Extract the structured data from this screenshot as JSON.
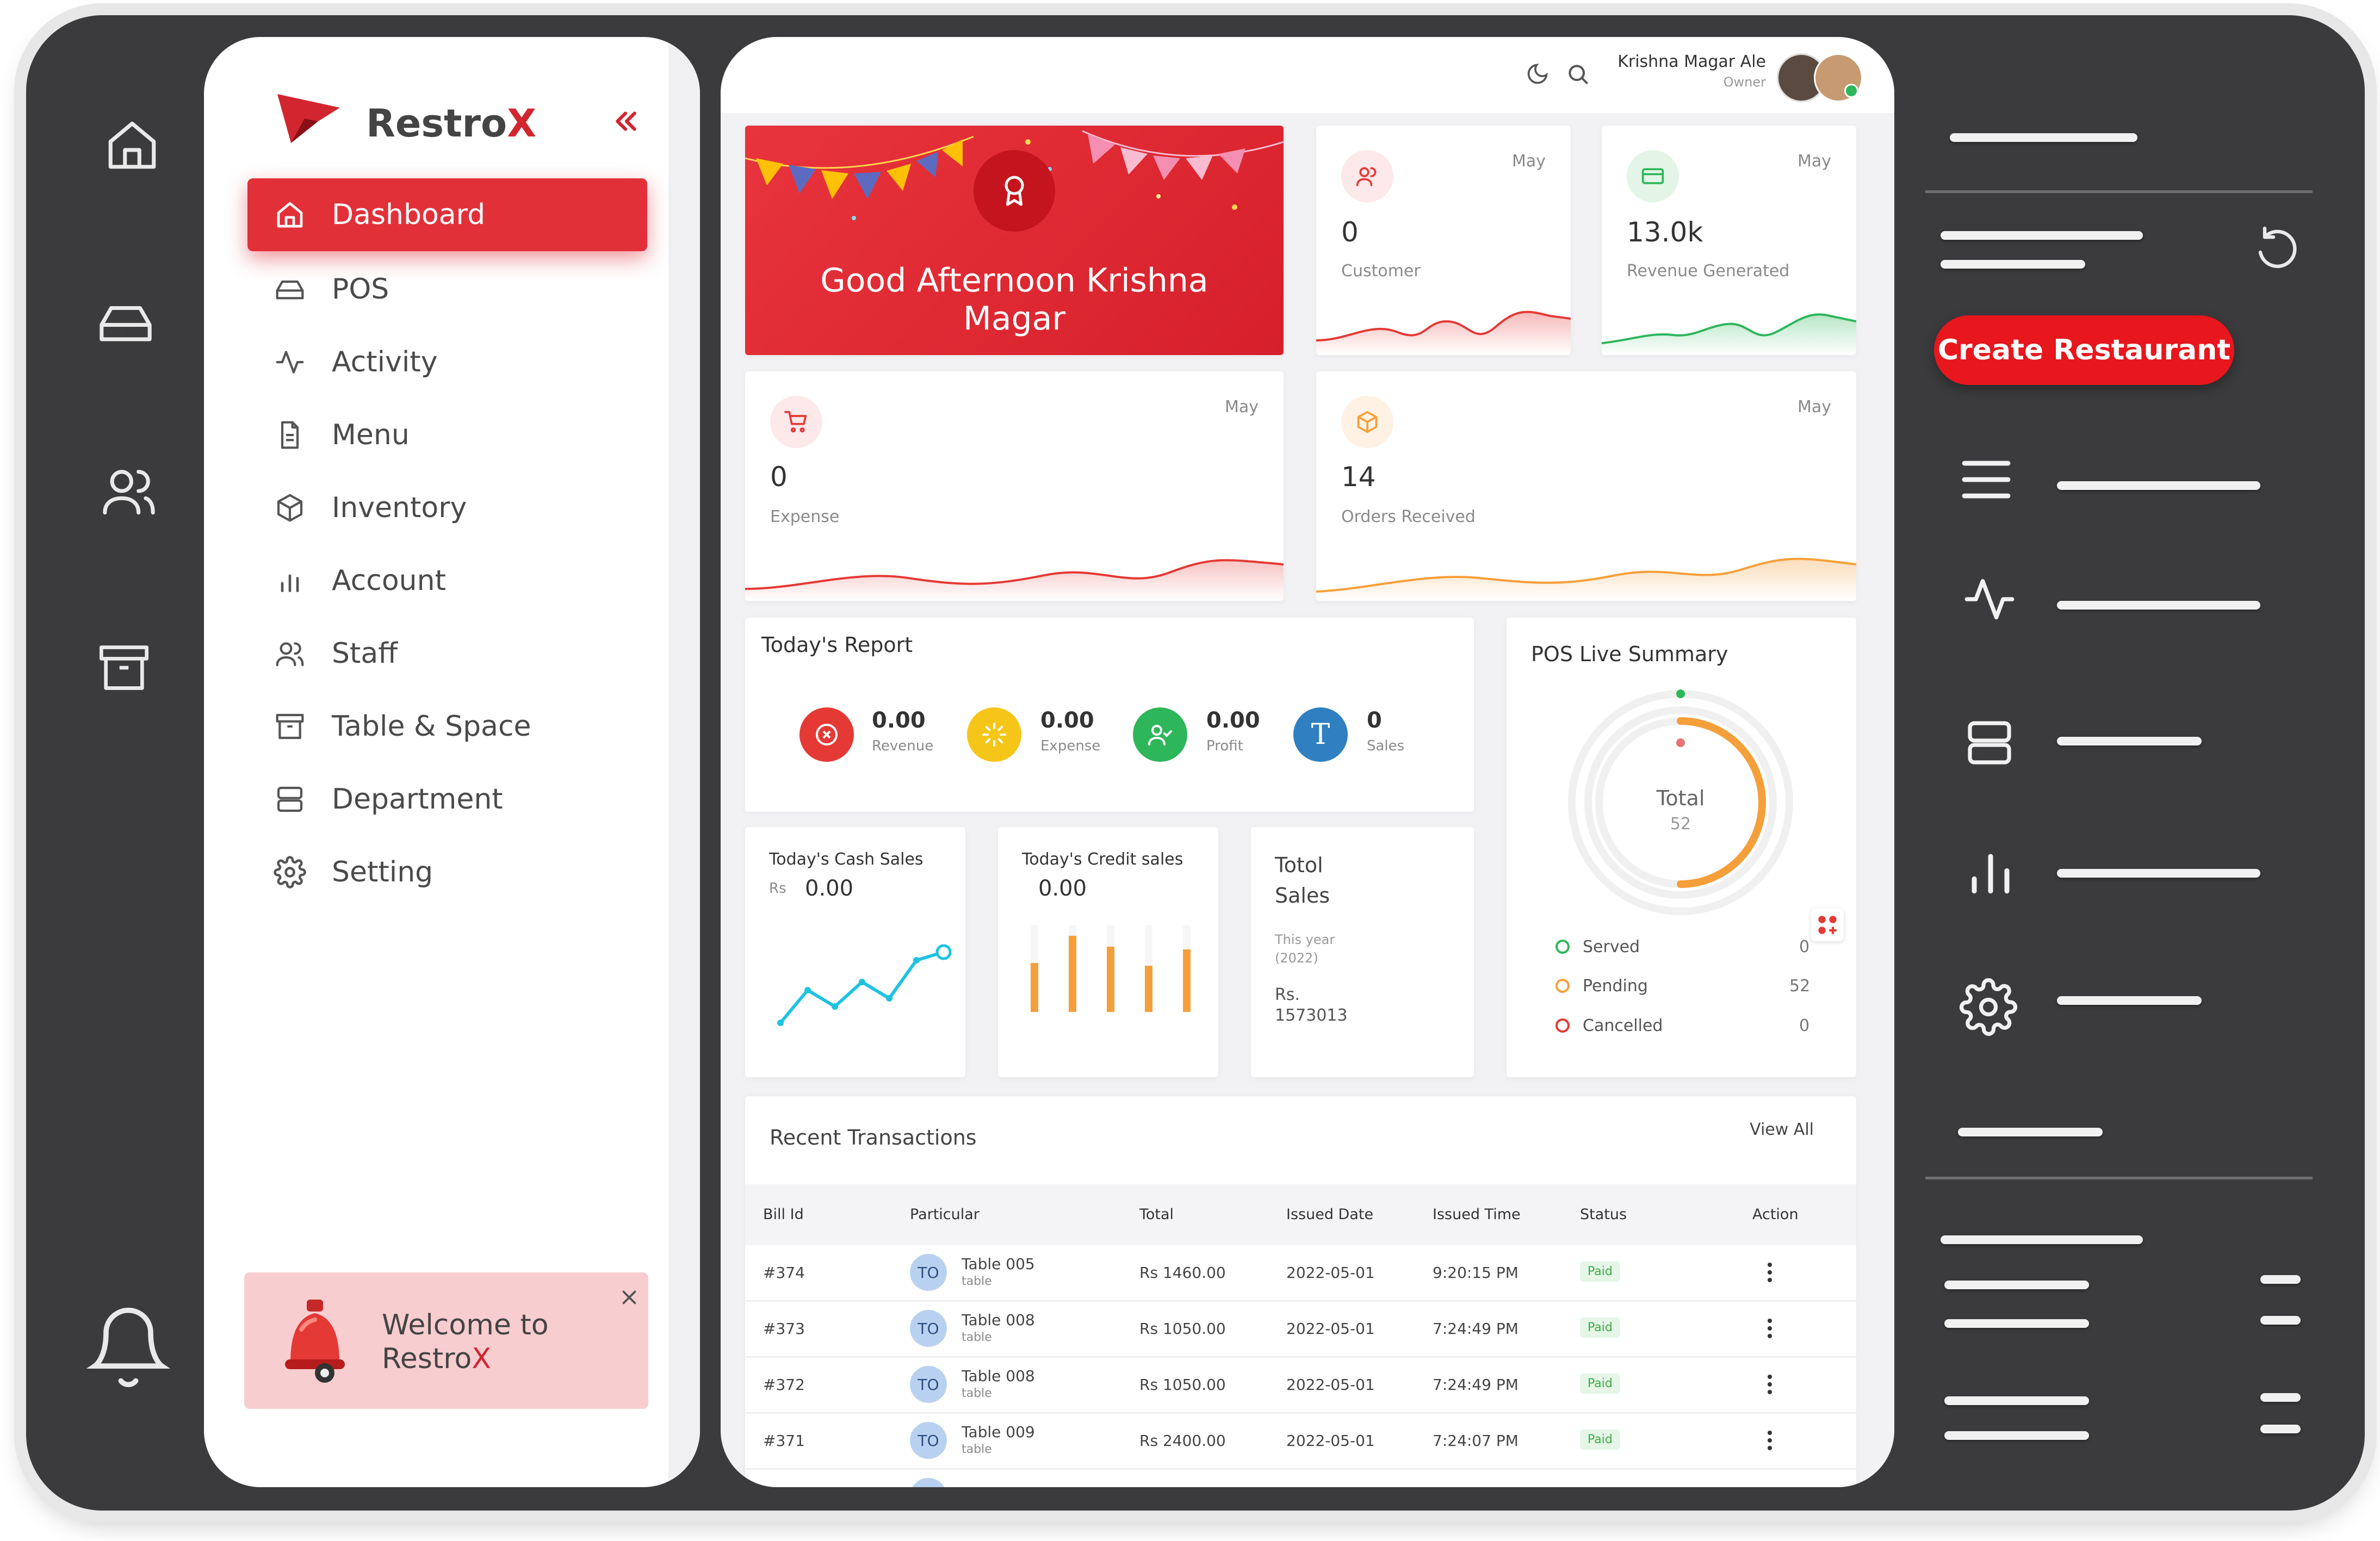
{
  "brand": {
    "name_main": "Restro",
    "name_accent": "X"
  },
  "nav": [
    {
      "label": "Dashboard",
      "icon": "home-icon",
      "active": true
    },
    {
      "label": "POS",
      "icon": "drive-icon"
    },
    {
      "label": "Activity",
      "icon": "activity-icon"
    },
    {
      "label": "Menu",
      "icon": "file-icon"
    },
    {
      "label": "Inventory",
      "icon": "box-icon"
    },
    {
      "label": "Account",
      "icon": "bar-chart-icon"
    },
    {
      "label": "Staff",
      "icon": "users-icon"
    },
    {
      "label": "Table & Space",
      "icon": "archive-icon"
    },
    {
      "label": "Department",
      "icon": "server-icon"
    },
    {
      "label": "Setting",
      "icon": "gear-icon"
    }
  ],
  "welcome": {
    "line1": "Welcome to",
    "line2_main": "Restro",
    "line2_accent": "X"
  },
  "user": {
    "name": "Krishna Magar Ale",
    "role": "Owner"
  },
  "greeting": {
    "line1": "Good Afternoon Krishna",
    "line2": "Magar"
  },
  "stats": {
    "customer": {
      "value": "0",
      "label": "Customer",
      "month": "May"
    },
    "revenue": {
      "value": "13.0k",
      "label": "Revenue Generated",
      "month": "May"
    },
    "expense": {
      "value": "0",
      "label": "Expense",
      "month": "May"
    },
    "orders": {
      "value": "14",
      "label": "Orders Received",
      "month": "May"
    }
  },
  "todays_report": {
    "title": "Today's Report",
    "items": [
      {
        "value": "0.00",
        "label": "Revenue",
        "color": "#e53935"
      },
      {
        "value": "0.00",
        "label": "Expense",
        "color": "#f5c518"
      },
      {
        "value": "0.00",
        "label": "Profit",
        "color": "#2eb65a"
      },
      {
        "value": "0",
        "label": "Sales",
        "color": "#2f7fc1",
        "glyph": "T"
      }
    ]
  },
  "cash_sales": {
    "title": "Today's Cash Sales",
    "currency": "Rs",
    "value": "0.00"
  },
  "credit_sales": {
    "title": "Today's Credit sales",
    "value": "0.00"
  },
  "total_sales": {
    "title_line1": "Totol",
    "title_line2": "Sales",
    "period_line1": "This year",
    "period_line2": "(2022)",
    "amount_line1": "Rs.",
    "amount_line2": "1573013"
  },
  "pos_summary": {
    "title": "POS Live Summary",
    "center_label": "Total",
    "center_value": "52",
    "legend": [
      {
        "label": "Served",
        "value": "0",
        "color": "#2eb65a"
      },
      {
        "label": "Pending",
        "value": "52",
        "color": "#f59f3a"
      },
      {
        "label": "Cancelled",
        "value": "0",
        "color": "#e53935"
      }
    ]
  },
  "transactions": {
    "title": "Recent Transactions",
    "view_all": "View All",
    "columns": [
      "Bill Id",
      "Particular",
      "Total",
      "Issued Date",
      "Issued Time",
      "Status",
      "Action"
    ],
    "rows": [
      {
        "bill": "#374",
        "avatar": "TO",
        "particular": "Table 005",
        "sub": "table",
        "total": "Rs 1460.00",
        "date": "2022-05-01",
        "time": "9:20:15 PM",
        "status": "Paid"
      },
      {
        "bill": "#373",
        "avatar": "TO",
        "particular": "Table 008",
        "sub": "table",
        "total": "Rs 1050.00",
        "date": "2022-05-01",
        "time": "7:24:49 PM",
        "status": "Paid"
      },
      {
        "bill": "#372",
        "avatar": "TO",
        "particular": "Table 008",
        "sub": "table",
        "total": "Rs 1050.00",
        "date": "2022-05-01",
        "time": "7:24:49 PM",
        "status": "Paid"
      },
      {
        "bill": "#371",
        "avatar": "TO",
        "particular": "Table 009",
        "sub": "table",
        "total": "Rs 2400.00",
        "date": "2022-05-01",
        "time": "7:24:07 PM",
        "status": "Paid"
      }
    ]
  },
  "right_panel": {
    "create_button": "Create Restaurant"
  },
  "colors": {
    "accent": "#e23039",
    "dark_frame": "#3b3b3d",
    "green": "#2eb65a",
    "orange": "#f59f3a"
  }
}
